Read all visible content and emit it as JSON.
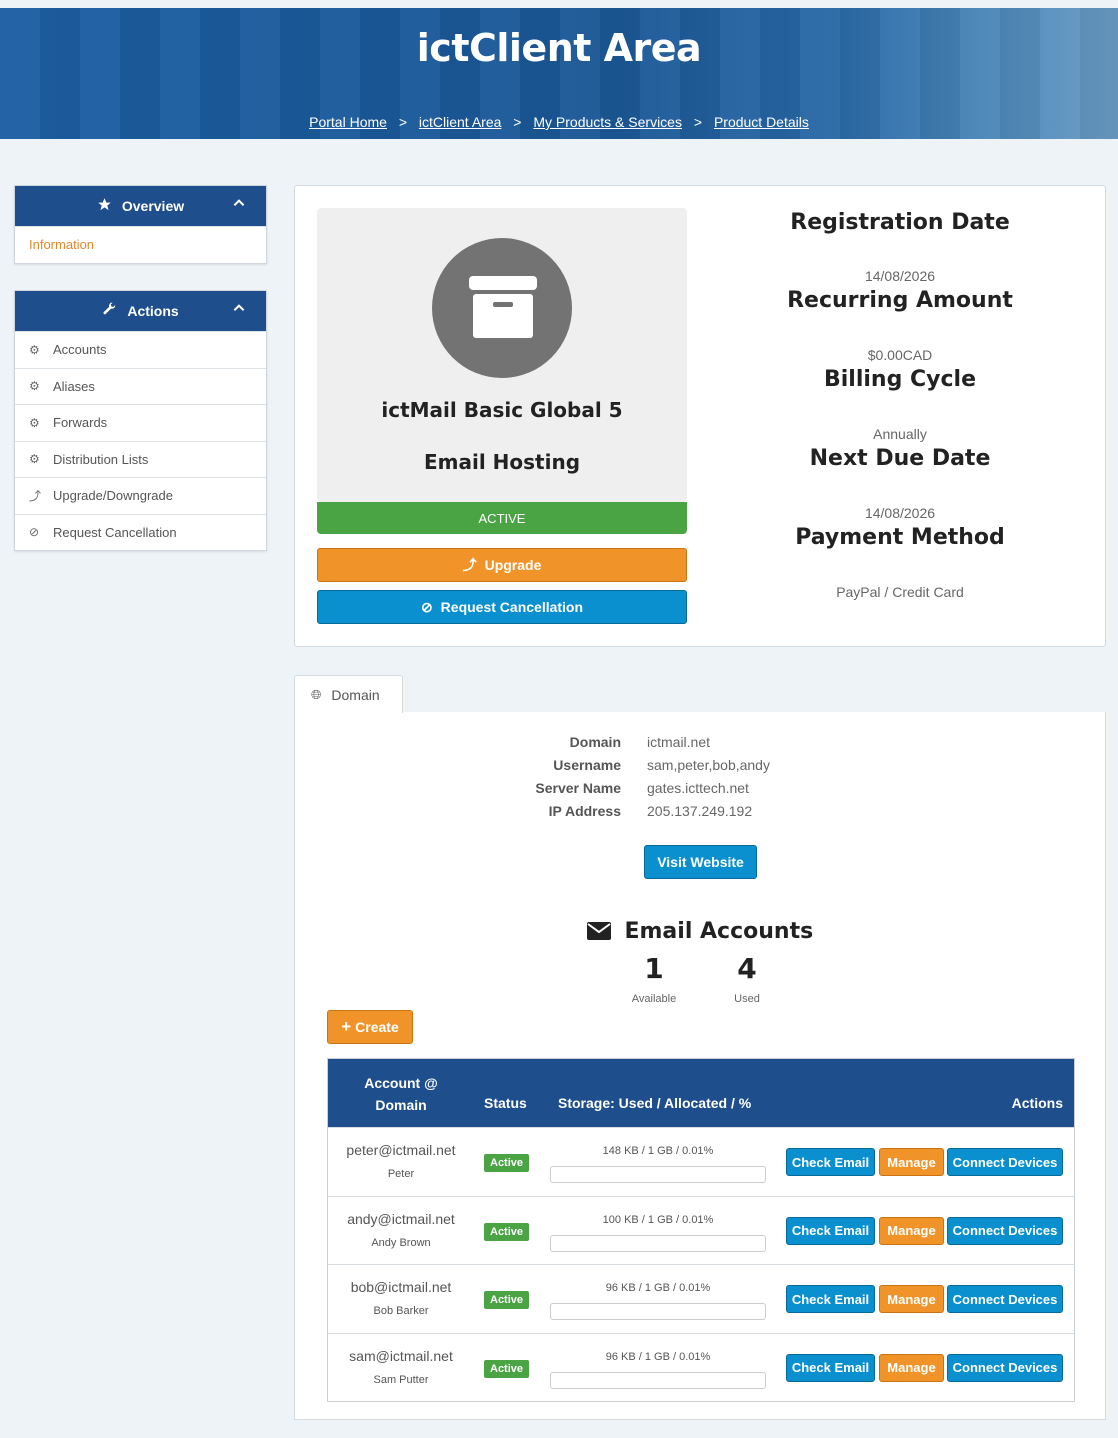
{
  "header": {
    "title": "ictClient Area",
    "breadcrumb": [
      "Portal Home",
      "ictClient Area",
      "My Products & Services",
      "Product Details"
    ],
    "separator": ">"
  },
  "sidebar": {
    "overview": {
      "title": "Overview",
      "items": [
        {
          "label": "Information",
          "icon": "info"
        }
      ]
    },
    "actions": {
      "title": "Actions",
      "items": [
        {
          "label": "Accounts",
          "icon": "gears-icon"
        },
        {
          "label": "Aliases",
          "icon": "gears-icon"
        },
        {
          "label": "Forwards",
          "icon": "gears-icon"
        },
        {
          "label": "Distribution Lists",
          "icon": "gears-icon"
        },
        {
          "label": "Upgrade/Downgrade",
          "icon": "level-up-icon"
        },
        {
          "label": "Request Cancellation",
          "icon": "ban-icon"
        }
      ]
    }
  },
  "product": {
    "name": "ictMail Basic Global 5",
    "group": "Email Hosting",
    "status": "ACTIVE",
    "upgrade_label": "Upgrade",
    "cancel_label": "Request Cancellation"
  },
  "details": [
    {
      "label": "Registration Date",
      "value": "14/08/2026"
    },
    {
      "label": "Recurring Amount",
      "value": "$0.00CAD"
    },
    {
      "label": "Billing Cycle",
      "value": "Annually"
    },
    {
      "label": "Next Due Date",
      "value": "14/08/2026"
    },
    {
      "label": "Payment Method",
      "value": "PayPal / Credit Card"
    }
  ],
  "domain_tab": {
    "label": "Domain",
    "fields": [
      {
        "label": "Domain",
        "value": "ictmail.net"
      },
      {
        "label": "Username",
        "value": "sam,peter,bob,andy"
      },
      {
        "label": "Server Name",
        "value": "gates.icttech.net"
      },
      {
        "label": "IP Address",
        "value": "205.137.249.192"
      }
    ],
    "visit_label": "Visit Website"
  },
  "email_accounts": {
    "title": "Email Accounts",
    "available": "1",
    "available_label": "Available",
    "used": "4",
    "used_label": "Used",
    "create_label": "Create",
    "columns": {
      "account_line1": "Account @",
      "account_line2": "Domain",
      "status": "Status",
      "storage": "Storage: Used / Allocated / %",
      "actions": "Actions"
    },
    "rows": [
      {
        "email": "peter@ictmail.net",
        "name": "Peter",
        "status": "Active",
        "storage": "148 KB / 1 GB / 0.01%",
        "percent": 0.01
      },
      {
        "email": "andy@ictmail.net",
        "name": "Andy Brown",
        "status": "Active",
        "storage": "100 KB / 1 GB / 0.01%",
        "percent": 0.01
      },
      {
        "email": "bob@ictmail.net",
        "name": "Bob Barker",
        "status": "Active",
        "storage": "96 KB / 1 GB / 0.01%",
        "percent": 0.01
      },
      {
        "email": "sam@ictmail.net",
        "name": "Sam Putter",
        "status": "Active",
        "storage": "96 KB / 1 GB / 0.01%",
        "percent": 0.01
      }
    ],
    "row_actions": {
      "check": "Check Email",
      "manage": "Manage",
      "connect": "Connect Devices"
    }
  },
  "colors": {
    "primary": "#1e4e8c",
    "accent_orange": "#f0942a",
    "accent_blue": "#0b90cf",
    "success": "#4ba444"
  }
}
